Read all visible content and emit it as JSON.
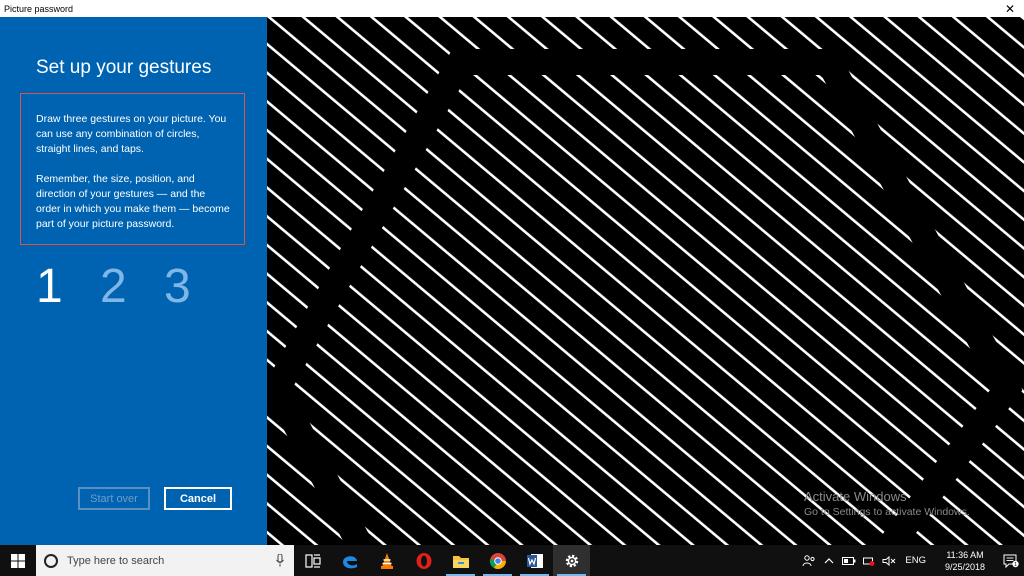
{
  "window": {
    "title": "Picture password",
    "close_glyph": "✕"
  },
  "panel": {
    "heading": "Set up your gestures",
    "instructions": [
      "Draw three gestures on your picture. You can use any combination of circles, straight lines, and taps.",
      "Remember, the size, position, and direction of your gestures — and the order in which you make them — become part of your picture password."
    ],
    "steps": [
      "1",
      "2",
      "3"
    ],
    "active_step": 1,
    "start_over_label": "Start over",
    "cancel_label": "Cancel"
  },
  "watermark": {
    "line1": "Activate Windows",
    "line2": "Go to Settings to activate Windows."
  },
  "taskbar": {
    "search_placeholder": "Type here to search",
    "apps": [
      {
        "name": "task-view",
        "icon": "task-view-icon"
      },
      {
        "name": "edge",
        "icon": "edge-icon"
      },
      {
        "name": "vlc",
        "icon": "vlc-icon"
      },
      {
        "name": "opera",
        "icon": "opera-icon"
      },
      {
        "name": "file-explorer",
        "icon": "folder-icon"
      },
      {
        "name": "chrome",
        "icon": "chrome-icon"
      },
      {
        "name": "word",
        "icon": "word-icon"
      },
      {
        "name": "settings",
        "icon": "gear-icon"
      }
    ],
    "language": "ENG",
    "time": "11:36 AM",
    "date": "9/25/2018",
    "notification_count": "1"
  },
  "colors": {
    "panel_blue": "#0063b1",
    "step_inactive": "#7fb6e8",
    "instructions_border": "#d9544f",
    "taskbar": "#101010"
  }
}
